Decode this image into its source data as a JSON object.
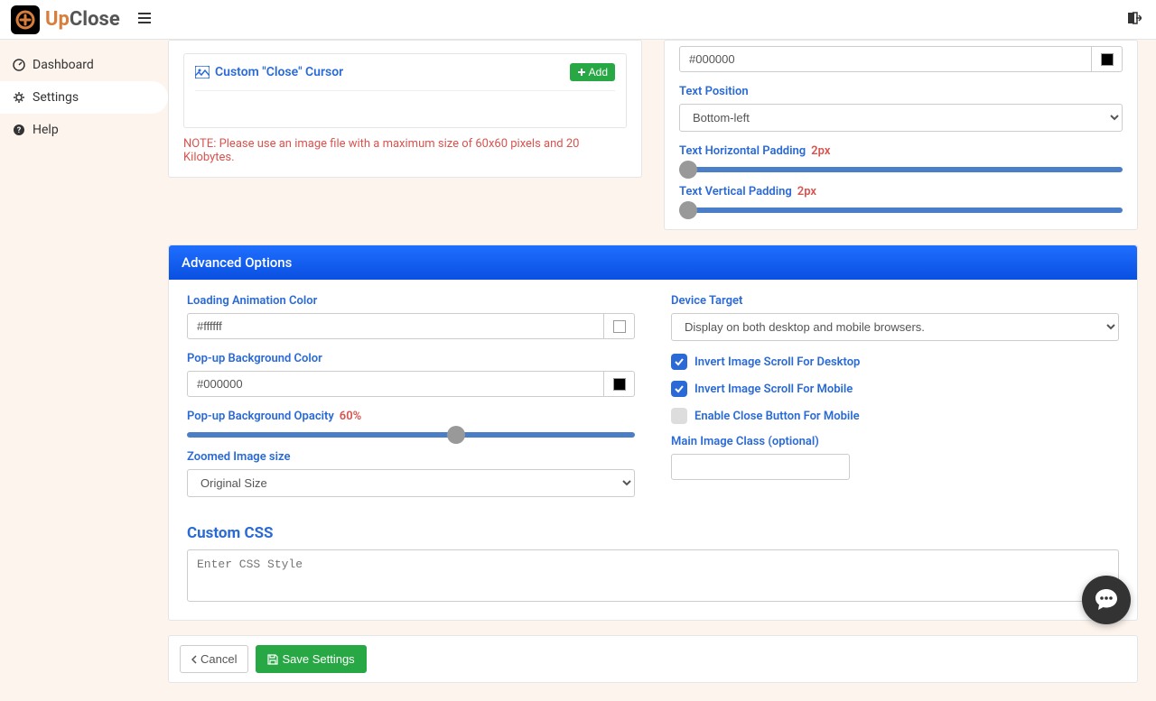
{
  "brand": {
    "part1": "Up",
    "part2": "Close"
  },
  "nav": {
    "dashboard": "Dashboard",
    "settings": "Settings",
    "help": "Help"
  },
  "cursor_card": {
    "title": "Custom \"Close\" Cursor",
    "add": "Add",
    "note": "NOTE: Please use an image file with a maximum size of 60x60 pixels and 20 Kilobytes."
  },
  "text_panel": {
    "color_value": "#000000",
    "color_swatch": "#000000",
    "position_label": "Text Position",
    "position_value": "Bottom-left",
    "hpad_label": "Text Horizontal Padding",
    "hpad_value": "2px",
    "hpad_pct": 2,
    "vpad_label": "Text Vertical Padding",
    "vpad_value": "2px",
    "vpad_pct": 2
  },
  "advanced": {
    "header": "Advanced Options",
    "loading_color_label": "Loading Animation Color",
    "loading_color_value": "#ffffff",
    "popup_bg_label": "Pop-up Background Color",
    "popup_bg_value": "#000000",
    "opacity_label": "Pop-up Background Opacity",
    "opacity_value": "60%",
    "opacity_pct": 60,
    "zoom_label": "Zoomed Image size",
    "zoom_value": "Original Size",
    "device_label": "Device Target",
    "device_value": "Display on both desktop and mobile browsers.",
    "invert_desktop": "Invert Image Scroll For Desktop",
    "invert_mobile": "Invert Image Scroll For Mobile",
    "close_mobile": "Enable Close Button For Mobile",
    "main_class_label": "Main Image Class (optional)",
    "custom_css_label": "Custom CSS",
    "css_placeholder": "Enter CSS Style"
  },
  "footer": {
    "cancel": "Cancel",
    "save": "Save Settings"
  }
}
